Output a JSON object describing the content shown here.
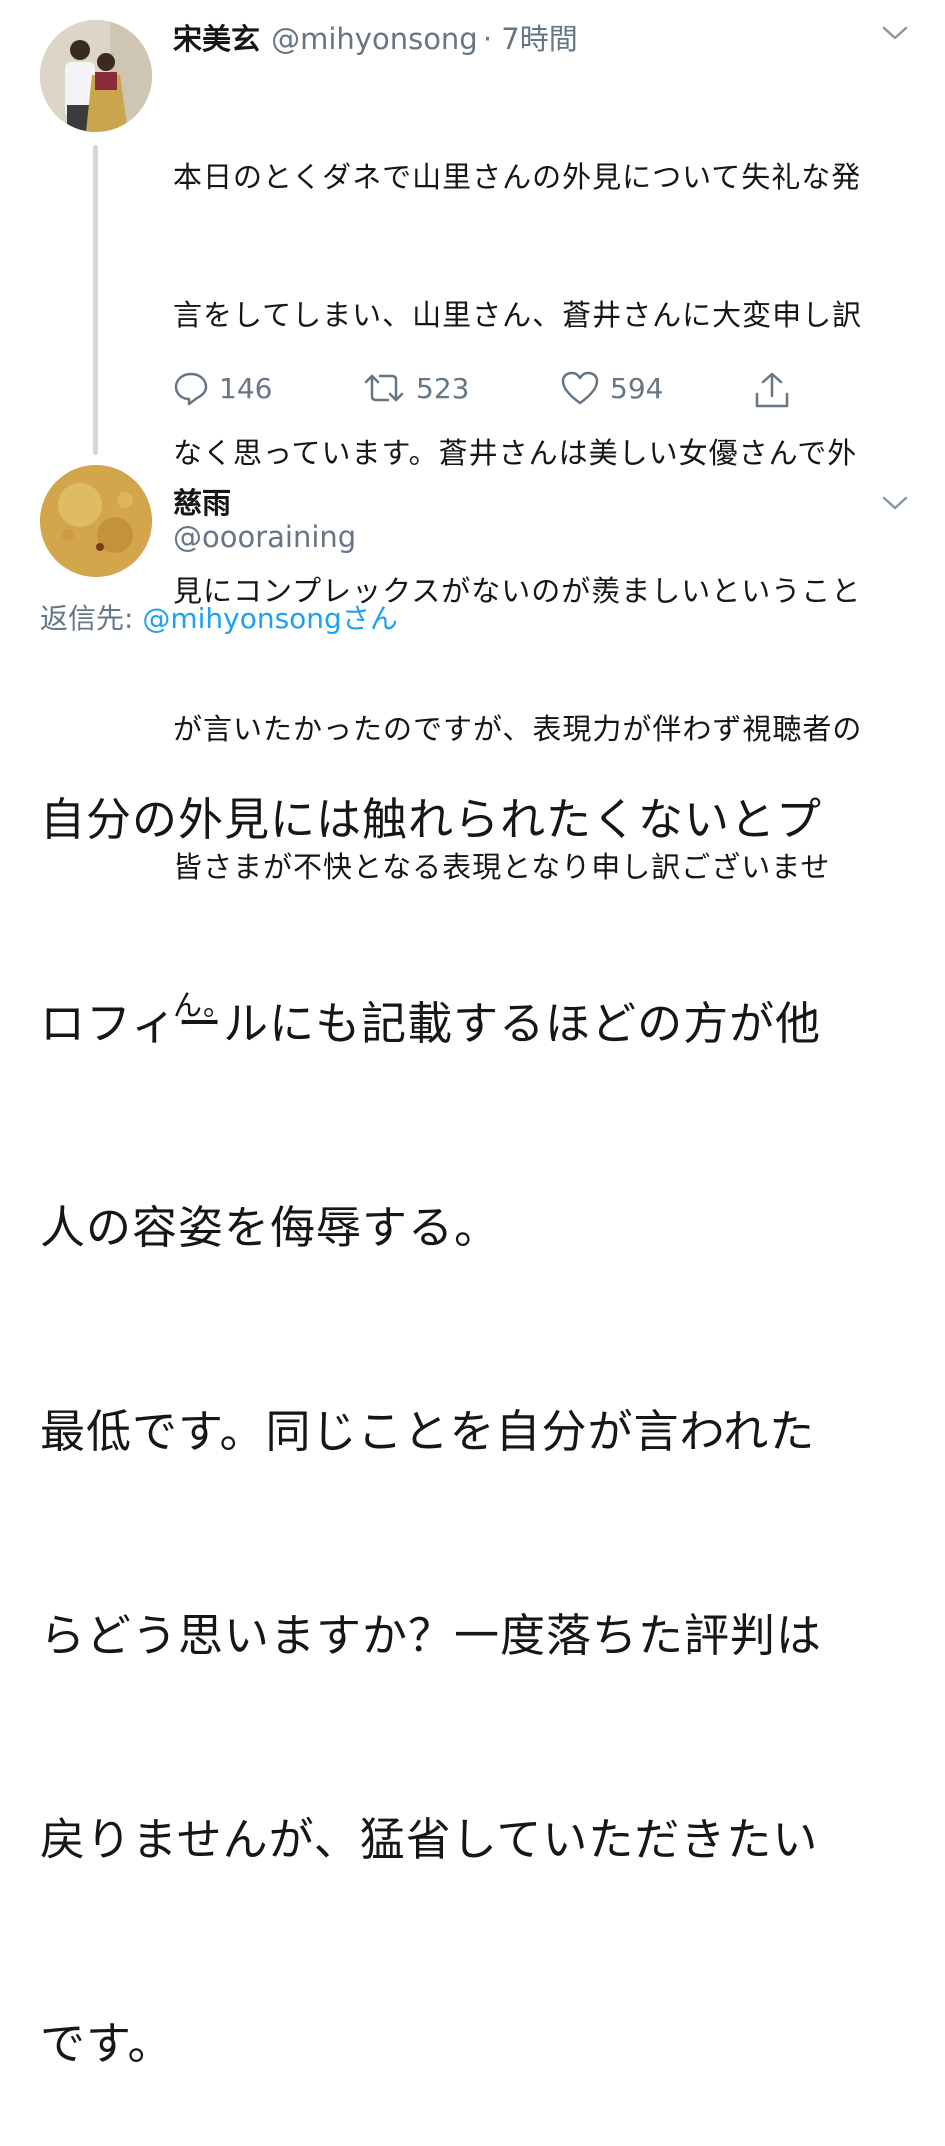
{
  "tweet1": {
    "author_name": "宋美玄",
    "handle": "@mihyonsong",
    "time": "· 7時間",
    "body_lines": [
      "本日のとくダネで山里さんの外見について失礼な発",
      "言をしてしまい、山里さん、蒼井さんに大変申し訳",
      "なく思っています。蒼井さんは美しい女優さんで外",
      "見にコンプレックスがないのが羨ましいということ",
      "が言いたかったのですが、表現力が伴わず視聴者の",
      "皆さまが不快となる表現となり申し訳ございませ",
      "ん。"
    ],
    "reply_count": "146",
    "retweet_count": "523",
    "like_count": "594"
  },
  "tweet2": {
    "author_name": "慈雨",
    "handle": "@oooraining",
    "reply_to_label": "返信先: ",
    "reply_to_user": "@mihyonsong",
    "reply_to_suffix": "さん",
    "body_lines": [
      "自分の外見には触れられたくないとプ",
      "ロフィールにも記載するほどの方が他",
      "人の容姿を侮辱する。",
      "最低です。同じことを自分が言われた",
      "らどう思いますか？一度落ちた評判は",
      "戻りませんが、猛省していただきたい",
      "です。"
    ]
  },
  "icons": {
    "menu": "chevron-down-icon",
    "reply": "reply-icon",
    "retweet": "retweet-icon",
    "like": "heart-icon",
    "share": "share-icon"
  },
  "colors": {
    "link": "#1da1f2",
    "secondary_text": "#657786",
    "thread_line": "#cfd9de"
  }
}
